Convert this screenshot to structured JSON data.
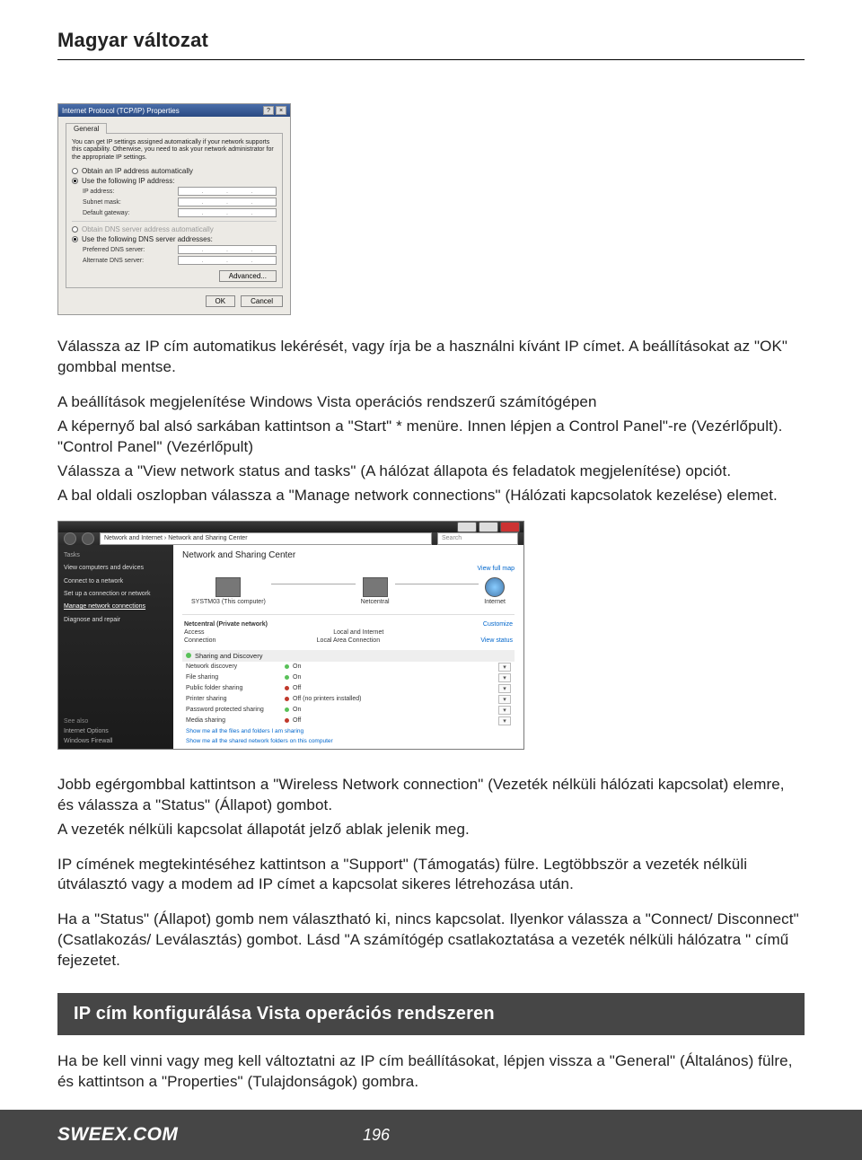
{
  "header": {
    "title": "Magyar változat"
  },
  "ip_dialog": {
    "title": "Internet Protocol (TCP/IP) Properties",
    "tab": "General",
    "description": "You can get IP settings assigned automatically if your network supports this capability. Otherwise, you need to ask your network administrator for the appropriate IP settings.",
    "radio_auto_ip": "Obtain an IP address automatically",
    "radio_use_ip": "Use the following IP address:",
    "ip_address_label": "IP address:",
    "subnet_label": "Subnet mask:",
    "gateway_label": "Default gateway:",
    "radio_auto_dns": "Obtain DNS server address automatically",
    "radio_use_dns": "Use the following DNS server addresses:",
    "pref_dns_label": "Preferred DNS server:",
    "alt_dns_label": "Alternate DNS server:",
    "advanced": "Advanced...",
    "ok": "OK",
    "cancel": "Cancel"
  },
  "paragraphs": {
    "p1": "Válassza az IP cím automatikus lekérését, vagy írja be a használni kívánt IP címet. A beállításokat az \"OK\" gombbal mentse.",
    "p2a": "A beállítások megjelenítése Windows Vista operációs rendszerű számítógépen",
    "p2b": "A képernyő bal alsó sarkában kattintson a \"Start\" * menüre. Innen lépjen a Control Panel\"-re (Vezérlőpult). \"Control Panel\" (Vezérlőpult)",
    "p2c": "Válassza a \"View network status and tasks\" (A hálózat állapota és feladatok megjelenítése) opciót.",
    "p2d": "A bal oldali oszlopban válassza a \"Manage network connections\" (Hálózati kapcsolatok kezelése) elemet.",
    "p3a": "Jobb egérgombbal kattintson a \"Wireless Network connection\" (Vezeték nélküli hálózati kapcsolat) elemre, és válassza a \"Status\" (Állapot) gombot.",
    "p3b": "A vezeték nélküli kapcsolat állapotát jelző ablak jelenik meg.",
    "p4": "IP címének megtekintéséhez kattintson a \"Support\" (Támogatás) fülre. Legtöbbször a vezeték nélküli útválasztó vagy a modem ad IP címet a kapcsolat sikeres létrehozása után.",
    "p5": "Ha a \"Status\" (Állapot) gomb nem választható ki, nincs kapcsolat. Ilyenkor válassza a \"Connect/ Disconnect\" (Csatlakozás/ Leválasztás) gombot. Lásd \"A számítógép csatlakoztatása a vezeték nélküli hálózatra \" című fejezetet.",
    "section_heading": "IP cím konfigurálása Vista operációs rendszeren",
    "p6": "Ha be kell vinni vagy meg kell változtatni az IP cím beállításokat, lépjen vissza a \"General\" (Általános) fülre, és kattintson a \"Properties\" (Tulajdonságok) gombra."
  },
  "vista": {
    "breadcrumb": "Network and Internet › Network and Sharing Center",
    "search_placeholder": "Search",
    "side": {
      "tasks_header": "Tasks",
      "tasks": [
        "View computers and devices",
        "Connect to a network",
        "Set up a connection or network",
        "Manage network connections",
        "Diagnose and repair"
      ],
      "seealso_header": "See also",
      "seealso": [
        "Internet Options",
        "Windows Firewall"
      ]
    },
    "content": {
      "title": "Network and Sharing Center",
      "view_full_map": "View full map",
      "node_pc": "SYSTM03 (This computer)",
      "node_net": "Netcentral",
      "node_internet": "Internet",
      "net_row_label": "Netcentral (Private network)",
      "net_row_action": "Customize",
      "access_label": "Access",
      "access_value": "Local and Internet",
      "connection_label": "Connection",
      "connection_value": "Local Area Connection",
      "connection_action": "View status",
      "sharing_header": "Sharing and Discovery",
      "rows": [
        {
          "label": "Network discovery",
          "value": "On",
          "on": true
        },
        {
          "label": "File sharing",
          "value": "On",
          "on": true
        },
        {
          "label": "Public folder sharing",
          "value": "Off",
          "on": false
        },
        {
          "label": "Printer sharing",
          "value": "Off (no printers installed)",
          "on": false
        },
        {
          "label": "Password protected sharing",
          "value": "On",
          "on": true
        },
        {
          "label": "Media sharing",
          "value": "Off",
          "on": false
        }
      ],
      "footer1": "Show me all the files and folders I am sharing",
      "footer2": "Show me all the shared network folders on this computer"
    }
  },
  "footer": {
    "brand": "SWEEX.COM",
    "page": "196"
  }
}
